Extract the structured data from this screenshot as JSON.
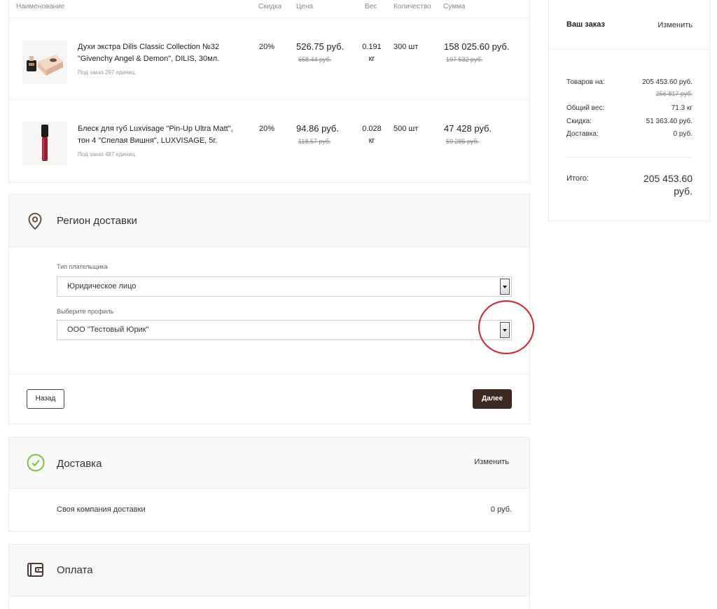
{
  "table": {
    "headers": {
      "name": "Наименование",
      "discount": "Скидка",
      "price": "Цена",
      "weight": "Вес",
      "qty": "Количество",
      "sum": "Сумма"
    },
    "rows": [
      {
        "name": "Духи экстра Dilis Classic Collection №32 \"Givenchy Angel & Demon\", DILIS, 30мл.",
        "note": "Под заказ  297 единиц.",
        "discount": "20%",
        "price": "526.75 руб.",
        "price_old": "658.44 руб.",
        "weight": "0.191 кг",
        "qty": "300 шт",
        "sum": "158 025.60 руб.",
        "sum_old": "197 532 руб.",
        "image_icon": "perfume-product-image"
      },
      {
        "name": "Блеск для губ Luxvisage \"Pin-Up Ultra Matt\", тон 4 \"Спелая Вишня\", LUXVISAGE, 5г.",
        "note": "Под заказ  487 единиц.",
        "discount": "20%",
        "price": "94.86 руб.",
        "price_old": "118.57 руб.",
        "weight": "0.028 кг",
        "qty": "500 шт",
        "sum": "47 428 руб.",
        "sum_old": "59 285 руб.",
        "image_icon": "lip-gloss-product-image"
      }
    ]
  },
  "summary": {
    "title": "Ваш заказ",
    "edit_label": "Изменить",
    "goods_label": "Товаров на:",
    "goods_value": "205 453.60 руб.",
    "goods_old": "256 817 руб.",
    "weight_label": "Общий вес:",
    "weight_value": "71.3 кг",
    "discount_label": "Скидка:",
    "discount_value": "51 363.40 руб.",
    "delivery_label": "Доставка:",
    "delivery_value": "0 руб.",
    "total_label": "Итого:",
    "total_value": "205 453.60 руб."
  },
  "region": {
    "title": "Регион доставки",
    "icon": "location-pin-icon",
    "payer_label": "Тип плательщика",
    "payer_value": "Юридическое лицо",
    "profile_label": "Выберите профиль",
    "profile_value": "ООО \"Тестовый Юрик\"",
    "back_label": "Назад",
    "next_label": "Далее"
  },
  "delivery": {
    "title": "Доставка",
    "icon": "check-circle-icon",
    "edit_label": "Изменить",
    "service_name": "Своя компания доставки",
    "service_price": "0 руб."
  },
  "payment": {
    "title": "Оплата",
    "icon": "wallet-icon"
  },
  "colors": {
    "accent_dark": "#3a2a22",
    "success_green": "#7dc242",
    "annotation_red": "#d6232e"
  }
}
